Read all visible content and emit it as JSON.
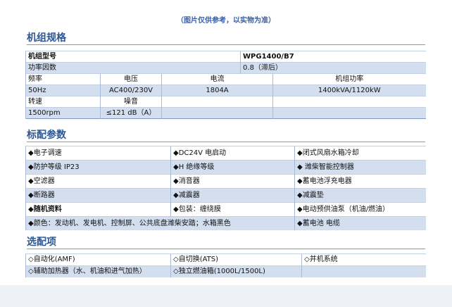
{
  "note": "（图片仅供参考，以实物为准）",
  "spec": {
    "title": "机组规格",
    "model_label": "机组型号",
    "model_value": "WPG1400/B7",
    "pf_label": "功率因数",
    "pf_value": "0.8（滞后）",
    "freq_label": "频率",
    "voltage_label": "电压",
    "current_label": "电流",
    "power_label": "机组功率",
    "freq_value": "50Hz",
    "voltage_value": "AC400/230V",
    "current_value": "1804A",
    "power_value": "1400kVA/1120kW",
    "speed_label": "转速",
    "noise_label": "噪音",
    "speed_value": "1500rpm",
    "noise_value": "≤121 dB（A）"
  },
  "standard": {
    "title": "标配参数",
    "rows": [
      [
        "◆电子调速",
        "◆DC24V 电启动",
        "◆闭式风扇水箱冷却"
      ],
      [
        "◆防护等级 IP23",
        "◆H 绝缘等级",
        "◆ 潍柴智能控制器"
      ],
      [
        "◆空滤器",
        "◆消音器",
        "◆蓄电池浮充电器"
      ],
      [
        "◆断路器",
        "◆减震器",
        "◆减震垫"
      ],
      [
        "◆随机资料",
        "◆包装：缠绕膜",
        "◆电动预供油泵（机油/燃油）"
      ]
    ],
    "last_wide": "◆颜色：发动机、发电机、控制屏、公共底盘潍柴安踏；水箱黑色",
    "last_right": "◆蓄电池 电缆"
  },
  "optional": {
    "title": "选配项",
    "row1": [
      "◇自动化(AMF)",
      "◇自切换(ATS)",
      "◇并机系统"
    ],
    "row2_left": "◇辅助加热器（水、机油和进气加热）",
    "row2_mid": "◇独立燃油箱(1000L/1500L)"
  }
}
